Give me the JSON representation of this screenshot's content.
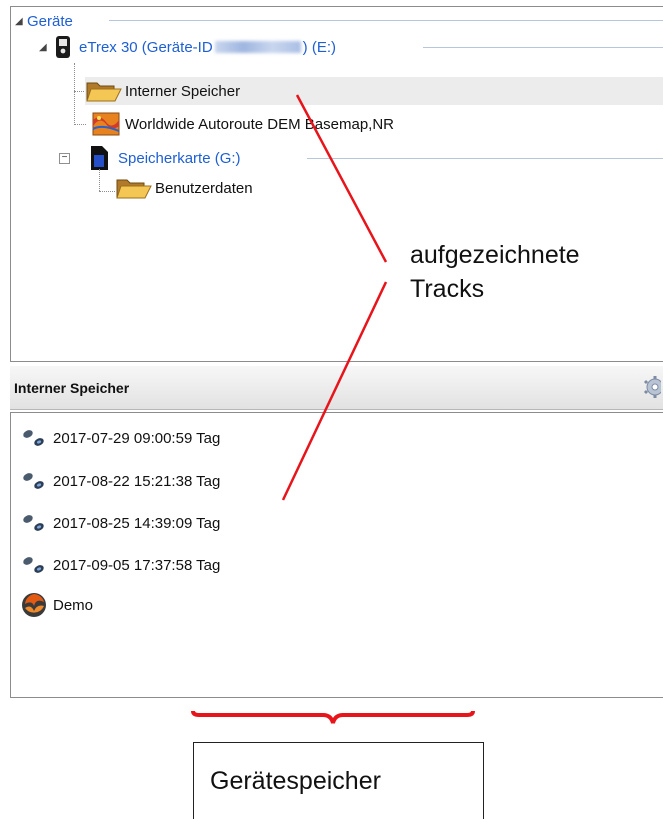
{
  "tree": {
    "root_label": "Geräte",
    "device": {
      "label_prefix": "eTrex 30 (Geräte-ID ",
      "label_suffix": ") (E:)"
    },
    "items": [
      {
        "label": "Interner Speicher",
        "icon": "folder-icon",
        "selected": true
      },
      {
        "label": "Worldwide Autoroute DEM Basemap,NR",
        "icon": "map-icon"
      }
    ],
    "sdcard": {
      "label": "Speicherkarte (G:)",
      "icon": "sd-card-icon"
    },
    "sdcard_items": [
      {
        "label": "Benutzerdaten",
        "icon": "folder-icon"
      }
    ]
  },
  "detail": {
    "title": "Interner Speicher",
    "settings_icon": "gear-icon",
    "items": [
      {
        "label": "2017-07-29 09:00:59 Tag",
        "icon": "footprints-icon"
      },
      {
        "label": "2017-08-22 15:21:38 Tag",
        "icon": "footprints-icon"
      },
      {
        "label": "2017-08-25 14:39:09 Tag",
        "icon": "footprints-icon"
      },
      {
        "label": "2017-09-05 17:37:58 Tag",
        "icon": "footprints-icon"
      },
      {
        "label": "Demo",
        "icon": "globe-icon"
      }
    ]
  },
  "annotations": {
    "tracks_line1": "aufgezeichnete",
    "tracks_line2": "Tracks",
    "storage_label": "Gerätespeicher",
    "color": "#e8141b"
  }
}
